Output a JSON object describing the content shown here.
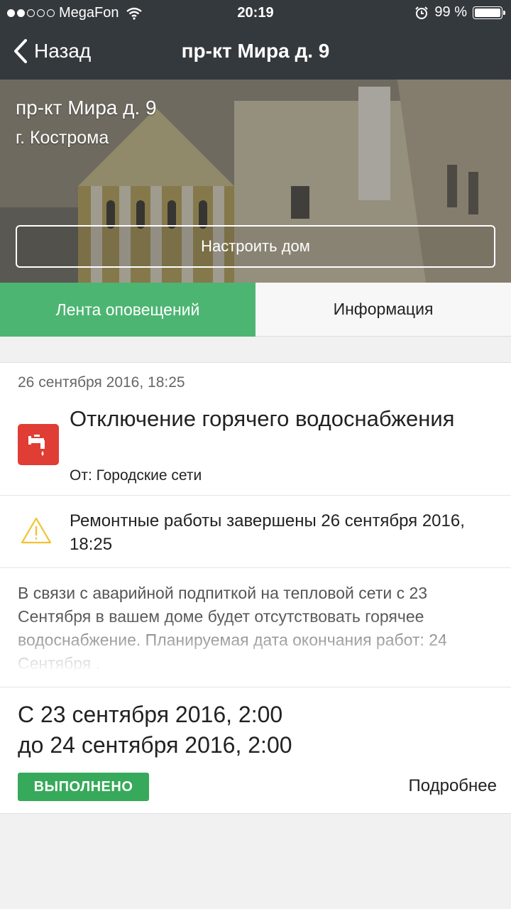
{
  "status_bar": {
    "carrier": "MegaFon",
    "time": "20:19",
    "battery": "99 %"
  },
  "nav": {
    "back_label": "Назад",
    "title": "пр-кт Мира д. 9"
  },
  "hero": {
    "address": "пр-кт Мира д. 9",
    "city": "г. Кострома",
    "configure_button": "Настроить дом"
  },
  "tabs": [
    {
      "label": "Лента оповещений",
      "active": true
    },
    {
      "label": "Информация",
      "active": false
    }
  ],
  "event": {
    "date": "26 сентября 2016, 18:25",
    "title": "Отключение горячего водоснабжения",
    "from": "От: Городские сети",
    "notice": "Ремонтные работы завершены 26 сентября 2016, 18:25",
    "description": "В связи с аварийной подпиткой на тепловой сети с 23 Сентября  в вашем доме будет отсутствовать горячее водоснабжение. Планируемая дата окончания работ: 24 Сентября .",
    "period_from": "С 23 сентября 2016, 2:00",
    "period_to": "до 24 сентября 2016, 2:00",
    "status_badge": "ВЫПОЛНЕНО",
    "more_link": "Подробнее"
  },
  "colors": {
    "header_bg": "#34393e",
    "tab_active": "#4cb572",
    "badge_done": "#37a95a",
    "event_icon_bg": "#e03d34",
    "warning_icon": "#f1c232"
  },
  "icons": {
    "back": "chevron-left-icon",
    "event": "faucet-icon",
    "notice": "warning-triangle-icon"
  }
}
